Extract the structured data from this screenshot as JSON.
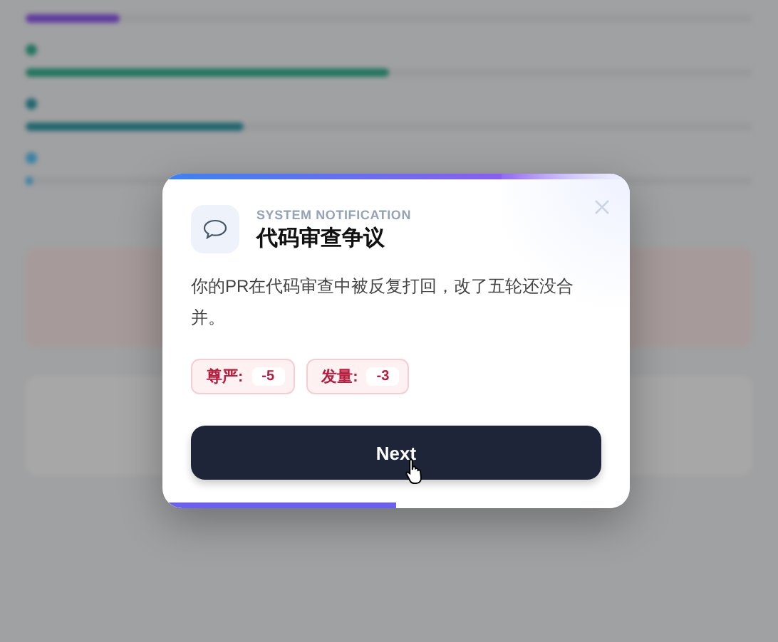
{
  "stats": [
    {
      "level": 0.13
    },
    {
      "level": 0.5
    },
    {
      "level": 0.3
    },
    {
      "level": 0.01
    }
  ],
  "dialog": {
    "eyebrow": "SYSTEM NOTIFICATION",
    "title": "代码审查争议",
    "message": "你的PR在代码审查中被反复打回，改了五轮还没合并。",
    "effects": [
      {
        "label": "尊严:",
        "value": "-5"
      },
      {
        "label": "发量:",
        "value": "-3"
      }
    ],
    "button": "Next",
    "level": 0.5
  }
}
